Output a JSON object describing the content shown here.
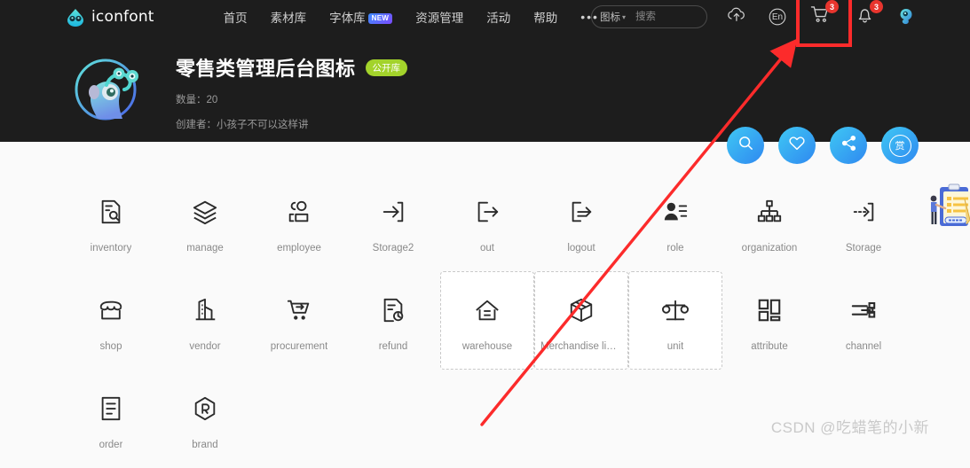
{
  "header": {
    "logo_text": "iconfont",
    "nav": [
      {
        "label": "首页",
        "badge": ""
      },
      {
        "label": "素材库",
        "badge": ""
      },
      {
        "label": "字体库",
        "badge": "NEW"
      },
      {
        "label": "资源管理",
        "badge": ""
      },
      {
        "label": "活动",
        "badge": ""
      },
      {
        "label": "帮助",
        "badge": ""
      }
    ],
    "more_dots": "•••",
    "search": {
      "category": "图标",
      "caret": "▾",
      "placeholder": "搜索",
      "value": ""
    },
    "actions": {
      "upload_icon": "cloud-upload-icon",
      "language_label": "En",
      "cart_badge": "3",
      "bell_badge": "3"
    }
  },
  "project": {
    "title": "零售类管理后台图标",
    "visibility_badge": "公开库",
    "count_label": "数量：",
    "count_value": "20",
    "author_label": "创建者：",
    "author_value": "小孩子不可以这样讲"
  },
  "fabs": [
    {
      "name": "search",
      "glyph": "search-icon"
    },
    {
      "name": "favorite",
      "glyph": "heart-icon"
    },
    {
      "name": "share",
      "glyph": "share-icon"
    },
    {
      "name": "reward",
      "glyph": "赏"
    }
  ],
  "icons": [
    {
      "label": "inventory",
      "glyph": "document-search-icon",
      "selected": false
    },
    {
      "label": "manage",
      "glyph": "layers-icon",
      "selected": false
    },
    {
      "label": "employee",
      "glyph": "users-icon",
      "selected": false
    },
    {
      "label": "Storage2",
      "glyph": "arrow-into-box-icon",
      "selected": false
    },
    {
      "label": "out",
      "glyph": "arrow-out-icon",
      "selected": false
    },
    {
      "label": "logout",
      "glyph": "logout-icon",
      "selected": false
    },
    {
      "label": "role",
      "glyph": "user-list-icon",
      "selected": false
    },
    {
      "label": "organization",
      "glyph": "org-chart-icon",
      "selected": false
    },
    {
      "label": "Storage",
      "glyph": "arrow-dashed-into-box-icon",
      "selected": false
    },
    {
      "label": "shop",
      "glyph": "storefront-icon",
      "selected": false
    },
    {
      "label": "vendor",
      "glyph": "building-icon",
      "selected": false
    },
    {
      "label": "procurement",
      "glyph": "cart-arrow-icon",
      "selected": false
    },
    {
      "label": "refund",
      "glyph": "document-refresh-icon",
      "selected": false
    },
    {
      "label": "warehouse",
      "glyph": "house-icon",
      "selected": true
    },
    {
      "label": "Merchandise libr...",
      "glyph": "box-icon",
      "selected": true
    },
    {
      "label": "unit",
      "glyph": "scales-icon",
      "selected": true
    },
    {
      "label": "attribute",
      "glyph": "blocks-icon",
      "selected": false
    },
    {
      "label": "channel",
      "glyph": "channel-icon",
      "selected": false
    },
    {
      "label": "order",
      "glyph": "document-lines-icon",
      "selected": false
    },
    {
      "label": "brand",
      "glyph": "registered-hex-icon",
      "selected": false
    }
  ],
  "annotations": {
    "box_target": "cart-button",
    "arrow_color": "#fc2b2b",
    "box_color": "#fc2b2b"
  },
  "watermark": "CSDN @吃蜡笔的小新",
  "colors": {
    "header_bg": "#1d1d1d",
    "page_bg": "#fafafa",
    "accent_blue": "#2f88f0",
    "badge_green": "#a3d32b",
    "badge_red": "#e8352e",
    "annotation_red": "#fc2b2b"
  }
}
